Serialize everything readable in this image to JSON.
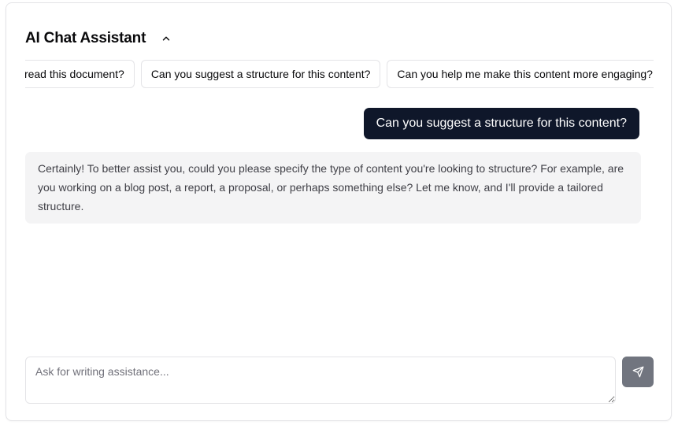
{
  "header": {
    "title": "AI Chat Assistant",
    "collapse_icon": "chevron-up-icon"
  },
  "suggestions": [
    "Can you proofread this document?",
    "Can you suggest a structure for this content?",
    "Can you help me make this content more engaging?",
    "…"
  ],
  "messages": [
    {
      "role": "user",
      "text": "Can you suggest a structure for this content?"
    },
    {
      "role": "assistant",
      "text": "Certainly! To better assist you, could you please specify the type of content you're looking to structure? For example, are you working on a blog post, a report, a proposal, or perhaps something else? Let me know, and I'll provide a tailored structure."
    }
  ],
  "composer": {
    "placeholder": "Ask for writing assistance...",
    "value": "",
    "send_icon": "send-icon"
  },
  "colors": {
    "user_bubble": "#0f172a",
    "assistant_bubble": "#f4f4f5",
    "send_button": "#71757f",
    "border": "#e4e4e7"
  }
}
